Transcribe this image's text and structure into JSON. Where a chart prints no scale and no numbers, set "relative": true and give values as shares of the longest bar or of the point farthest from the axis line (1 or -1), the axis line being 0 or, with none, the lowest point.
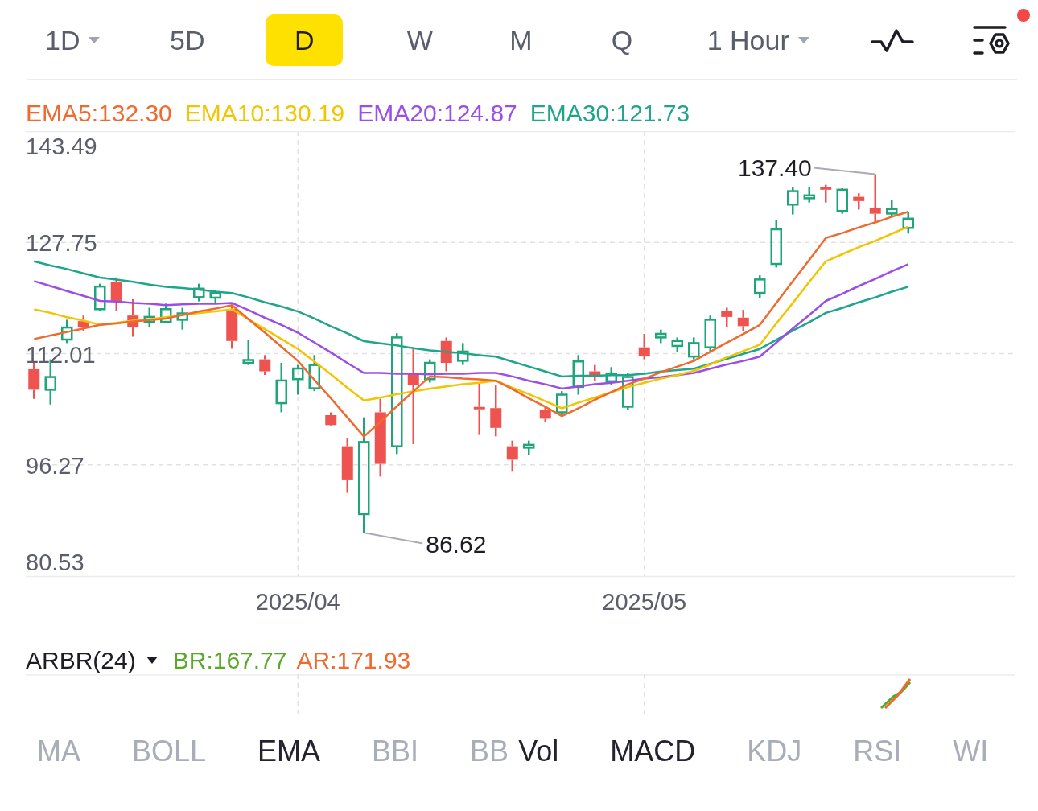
{
  "timeframes": [
    {
      "label": "1D",
      "dropdown": true,
      "selected": false
    },
    {
      "label": "5D",
      "dropdown": false,
      "selected": false
    },
    {
      "label": "D",
      "dropdown": false,
      "selected": true
    },
    {
      "label": "W",
      "dropdown": false,
      "selected": false
    },
    {
      "label": "M",
      "dropdown": false,
      "selected": false
    },
    {
      "label": "Q",
      "dropdown": false,
      "selected": false
    },
    {
      "label": "1 Hour",
      "dropdown": true,
      "selected": false
    }
  ],
  "settings": {
    "notification": true
  },
  "price_chart": {
    "chart_data": {
      "type": "candlestick",
      "grid": true,
      "ylim": [
        80.53,
        143.49
      ],
      "yticks": [
        143.49,
        127.75,
        112.01,
        96.27,
        80.53
      ],
      "categories": [
        null,
        null,
        null,
        null,
        null,
        null,
        null,
        null,
        null,
        null,
        null,
        null,
        null,
        null,
        null,
        null,
        "2025/04",
        null,
        null,
        null,
        null,
        null,
        null,
        null,
        null,
        null,
        null,
        null,
        null,
        null,
        null,
        null,
        null,
        null,
        null,
        null,
        null,
        "2025/05",
        null,
        null,
        null,
        null,
        null,
        null,
        null,
        null,
        null,
        null,
        null,
        null,
        null,
        null,
        null,
        null,
        null,
        null,
        null,
        null,
        null,
        null
      ],
      "ohlc": [
        [
          109.8,
          110.7,
          105.6,
          106.9
        ],
        [
          106.9,
          111.2,
          104.8,
          108.7
        ],
        [
          114.0,
          116.8,
          113.5,
          115.7
        ],
        [
          116.6,
          117.4,
          115.2,
          115.7
        ],
        [
          118.3,
          121.9,
          118.0,
          121.5
        ],
        [
          122.2,
          122.8,
          118.0,
          119.4
        ],
        [
          117.4,
          119.7,
          114.4,
          115.7
        ],
        [
          116.5,
          118.5,
          115.7,
          117.2
        ],
        [
          116.5,
          119.1,
          116.3,
          118.3
        ],
        [
          116.8,
          118.5,
          115.4,
          117.7
        ],
        [
          120.0,
          121.9,
          119.4,
          121.2
        ],
        [
          120.1,
          121.0,
          119.1,
          120.4
        ],
        [
          118.3,
          118.8,
          112.7,
          113.8
        ],
        [
          110.7,
          114.0,
          110.4,
          111.1
        ],
        [
          111.2,
          111.8,
          109.0,
          109.5
        ],
        [
          105.0,
          110.7,
          103.7,
          108.2
        ],
        [
          108.4,
          110.4,
          106.2,
          109.9
        ],
        [
          107.1,
          111.8,
          106.7,
          110.4
        ],
        [
          103.3,
          103.7,
          101.7,
          101.9
        ],
        [
          98.9,
          100.0,
          92.3,
          94.2
        ],
        [
          89.3,
          103.0,
          86.62,
          99.5
        ],
        [
          103.7,
          105.6,
          94.6,
          96.4
        ],
        [
          98.9,
          114.9,
          97.8,
          114.3
        ],
        [
          109.3,
          112.9,
          99.2,
          107.6
        ],
        [
          108.4,
          111.2,
          107.9,
          110.7
        ],
        [
          113.8,
          114.3,
          109.5,
          110.7
        ],
        [
          111.0,
          113.5,
          110.4,
          112.3
        ],
        [
          104.3,
          107.9,
          100.5,
          104.3
        ],
        [
          104.3,
          107.5,
          100.3,
          101.5
        ],
        [
          98.9,
          99.7,
          95.3,
          97.0
        ],
        [
          98.7,
          99.7,
          97.7,
          99.1
        ],
        [
          104.1,
          104.5,
          102.3,
          102.8
        ],
        [
          103.7,
          106.7,
          103.1,
          106.2
        ],
        [
          107.3,
          111.8,
          106.2,
          110.9
        ],
        [
          109.5,
          110.4,
          108.2,
          108.7
        ],
        [
          108.1,
          110.1,
          107.5,
          109.2
        ],
        [
          104.5,
          109.3,
          104.1,
          108.7
        ],
        [
          112.9,
          114.8,
          111.2,
          111.6
        ],
        [
          114.3,
          115.4,
          113.5,
          114.8
        ],
        [
          113.1,
          114.3,
          112.3,
          113.8
        ],
        [
          111.6,
          114.3,
          111.2,
          113.5
        ],
        [
          112.9,
          117.4,
          112.3,
          116.8
        ],
        [
          118.0,
          118.5,
          115.7,
          117.2
        ],
        [
          117.1,
          118.2,
          115.2,
          115.9
        ],
        [
          120.6,
          123.1,
          119.9,
          122.5
        ],
        [
          124.7,
          130.9,
          124.2,
          129.6
        ],
        [
          133.1,
          135.6,
          131.7,
          135.0
        ],
        [
          134.0,
          135.6,
          133.4,
          134.4
        ],
        [
          135.6,
          135.9,
          133.4,
          135.2
        ],
        [
          132.2,
          135.4,
          131.8,
          135.2
        ],
        [
          134.2,
          134.7,
          132.4,
          133.6
        ],
        [
          132.6,
          137.4,
          130.5,
          131.8
        ],
        [
          132.0,
          133.7,
          131.5,
          132.3
        ],
        [
          129.8,
          132.0,
          129.0,
          131.1
        ],
        null,
        null,
        null,
        null,
        null,
        null
      ],
      "annotations": [
        "137.40",
        "86.62"
      ]
    },
    "overlay": {
      "chart_data": {
        "type": "line",
        "relative": true,
        "ylim": [
          80.53,
          143.49
        ],
        "series": [
          {
            "name": "EMA5:132.30",
            "color": "#f06a2f",
            "values": [
              114.3,
              114.8,
              115.3,
              115.8,
              116.3,
              116.5,
              116.8,
              117.0,
              117.2,
              117.7,
              118.2,
              118.6,
              119.1,
              117.1,
              115.2,
              113.2,
              111.2,
              108.5,
              105.9,
              103.2,
              100.5,
              102.6,
              104.8,
              106.9,
              109.0,
              108.9,
              108.7,
              108.6,
              108.4,
              107.2,
              105.9,
              104.7,
              103.4,
              104.5,
              105.7,
              106.8,
              107.9,
              108.7,
              109.6,
              110.4,
              111.2,
              112.5,
              113.8,
              115.0,
              116.3,
              119.4,
              122.5,
              125.5,
              128.6,
              129.3,
              130.1,
              130.8,
              131.6,
              132.3,
              null,
              null,
              null,
              null,
              null,
              null
            ]
          },
          {
            "name": "EMA10:130.19",
            "color": "#f2c500",
            "values": [
              118.5,
              118.0,
              117.4,
              116.9,
              116.3,
              116.6,
              116.9,
              117.1,
              117.4,
              117.7,
              118.0,
              118.2,
              118.5,
              117.1,
              115.7,
              114.3,
              112.9,
              111.1,
              109.3,
              107.4,
              105.6,
              106.0,
              106.5,
              106.9,
              107.3,
              107.6,
              107.9,
              108.1,
              108.4,
              107.4,
              106.5,
              105.5,
              104.5,
              105.3,
              106.0,
              106.8,
              107.5,
              108.1,
              108.7,
              109.2,
              109.8,
              110.7,
              111.7,
              112.6,
              113.5,
              116.5,
              119.4,
              122.4,
              125.3,
              126.3,
              127.3,
              128.2,
              129.2,
              130.2,
              null,
              null,
              null,
              null,
              null,
              null
            ]
          },
          {
            "name": "EMA20:124.87",
            "color": "#9b4dea",
            "values": [
              122.5,
              121.8,
              121.1,
              120.4,
              119.7,
              119.6,
              119.4,
              119.3,
              119.1,
              119.2,
              119.3,
              119.3,
              119.4,
              118.4,
              117.3,
              116.3,
              115.2,
              113.8,
              112.4,
              110.9,
              109.5,
              109.5,
              109.4,
              109.4,
              109.3,
              109.4,
              109.4,
              109.5,
              109.5,
              109.0,
              108.4,
              107.9,
              107.3,
              107.6,
              107.9,
              108.1,
              108.4,
              108.7,
              108.9,
              109.2,
              109.5,
              110.1,
              110.7,
              111.2,
              111.8,
              113.8,
              115.8,
              117.7,
              119.7,
              120.7,
              121.8,
              122.8,
              123.9,
              124.9,
              null,
              null,
              null,
              null,
              null,
              null
            ]
          },
          {
            "name": "EMA30:121.73",
            "color": "#1fa58a",
            "values": [
              125.3,
              124.7,
              124.2,
              123.6,
              123.0,
              122.7,
              122.4,
              122.0,
              121.7,
              121.5,
              121.3,
              121.0,
              120.8,
              120.2,
              119.5,
              118.9,
              118.2,
              117.2,
              116.1,
              115.1,
              114.0,
              113.7,
              113.4,
              113.0,
              112.7,
              112.5,
              112.3,
              112.0,
              111.8,
              111.1,
              110.4,
              109.7,
              109.0,
              109.1,
              109.1,
              109.2,
              109.2,
              109.4,
              109.7,
              109.9,
              110.1,
              110.8,
              111.5,
              112.2,
              112.9,
              114.2,
              115.5,
              116.7,
              118.0,
              118.7,
              119.5,
              120.2,
              121.0,
              121.7,
              null,
              null,
              null,
              null,
              null,
              null
            ]
          }
        ]
      }
    }
  },
  "indicator": {
    "name": "ARBR(24)",
    "values": [
      {
        "text": "BR:167.77",
        "color": "#5aa829"
      },
      {
        "text": "AR:171.93",
        "color": "#f06a2f"
      }
    ]
  },
  "indicator_tabs": [
    [
      {
        "label": "MA",
        "selected": false
      },
      {
        "label": "BOLL",
        "selected": false
      },
      {
        "label": "EMA",
        "selected": true
      },
      {
        "label": "BBI",
        "selected": false
      },
      {
        "label": "BB",
        "selected": false
      }
    ],
    [
      {
        "label": "Vol",
        "selected": true
      },
      {
        "label": "MACD",
        "selected": true
      },
      {
        "label": "KDJ",
        "selected": false
      },
      {
        "label": "RSI",
        "selected": false
      },
      {
        "label": "WI",
        "selected": false
      }
    ]
  ]
}
